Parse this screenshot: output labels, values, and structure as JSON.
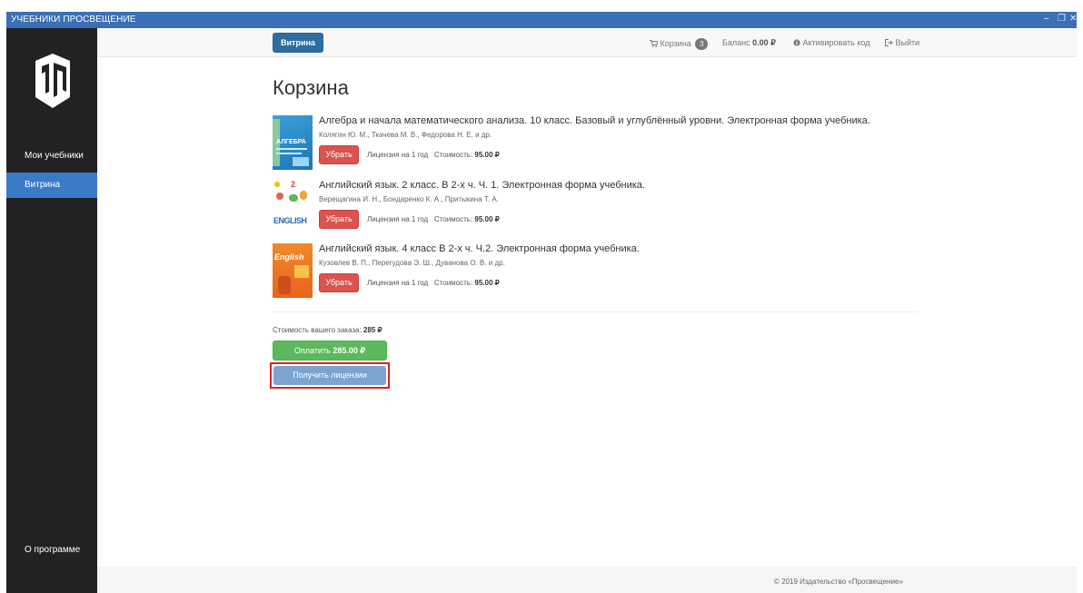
{
  "window": {
    "title": "УЧЕБНИКИ ПРОСВЕЩЕНИЕ",
    "minimize_glyph": "–",
    "restore_glyph": "❐",
    "close_glyph": "✕"
  },
  "sidebar": {
    "logo_icon": "prosveshchenie-logo-icon",
    "items": [
      {
        "label": "Мои учебники",
        "active": false
      },
      {
        "label": "Витрина",
        "active": true
      }
    ],
    "about_label": "О программе"
  },
  "topnav": {
    "vitrina_label": "Витрина",
    "cart_label": "Корзина",
    "cart_count": "3",
    "balance_label": "Баланс",
    "balance_value": "0.00 ₽",
    "activate_label": "Активировать код",
    "logout_label": "Выйти"
  },
  "main": {
    "title": "Корзина",
    "remove_label": "Убрать",
    "license_prefix": "Лицензия на 1 год",
    "cost_prefix": "Стоимость:",
    "items": [
      {
        "title": "Алгебра и начала математического анализа. 10 класс. Базовый и углублённый уровни. Электронная форма учебника.",
        "authors": "Колягин Ю. М., Ткачева М. В., Федорова Н. Е. и др.",
        "license": "Лицензия на 1 год",
        "cost": "95.00 ₽",
        "cover_text": "АЛГЕБРА"
      },
      {
        "title": "Английский язык. 2 класс. В 2-х ч. Ч. 1. Электронная форма учебника.",
        "authors": "Верещагина И. Н., Бондаренко К. А., Притыкина Т. А.",
        "license": "Лицензия на 1 год",
        "cost": "95.00 ₽",
        "cover_text": "ENGLISH"
      },
      {
        "title": "Английский язык. 4 класс В 2-х ч. Ч.2. Электронная форма учебника.",
        "authors": "Кузовлев В. П., Перегудова Э. Ш., Дуванова О. В. и др.",
        "license": "Лицензия на 1 год",
        "cost": "95.00 ₽",
        "cover_text": "English"
      }
    ],
    "order_total_label": "Стоимость вашего заказа:",
    "order_total_value": "285 ₽",
    "pay_label": "Оплатить",
    "pay_value": "285.00 ₽",
    "get_license_label": "Получить лицензии"
  },
  "footer": {
    "text": "© 2019 Издательство «Просвещение»"
  },
  "colors": {
    "titlebar": "#3b6fb6",
    "sidebar": "#222222",
    "sidebar_active": "#3a7bc8",
    "primary": "#2e6da4",
    "danger": "#d9534f",
    "success": "#5cb85c",
    "highlight": "#d9232a"
  }
}
